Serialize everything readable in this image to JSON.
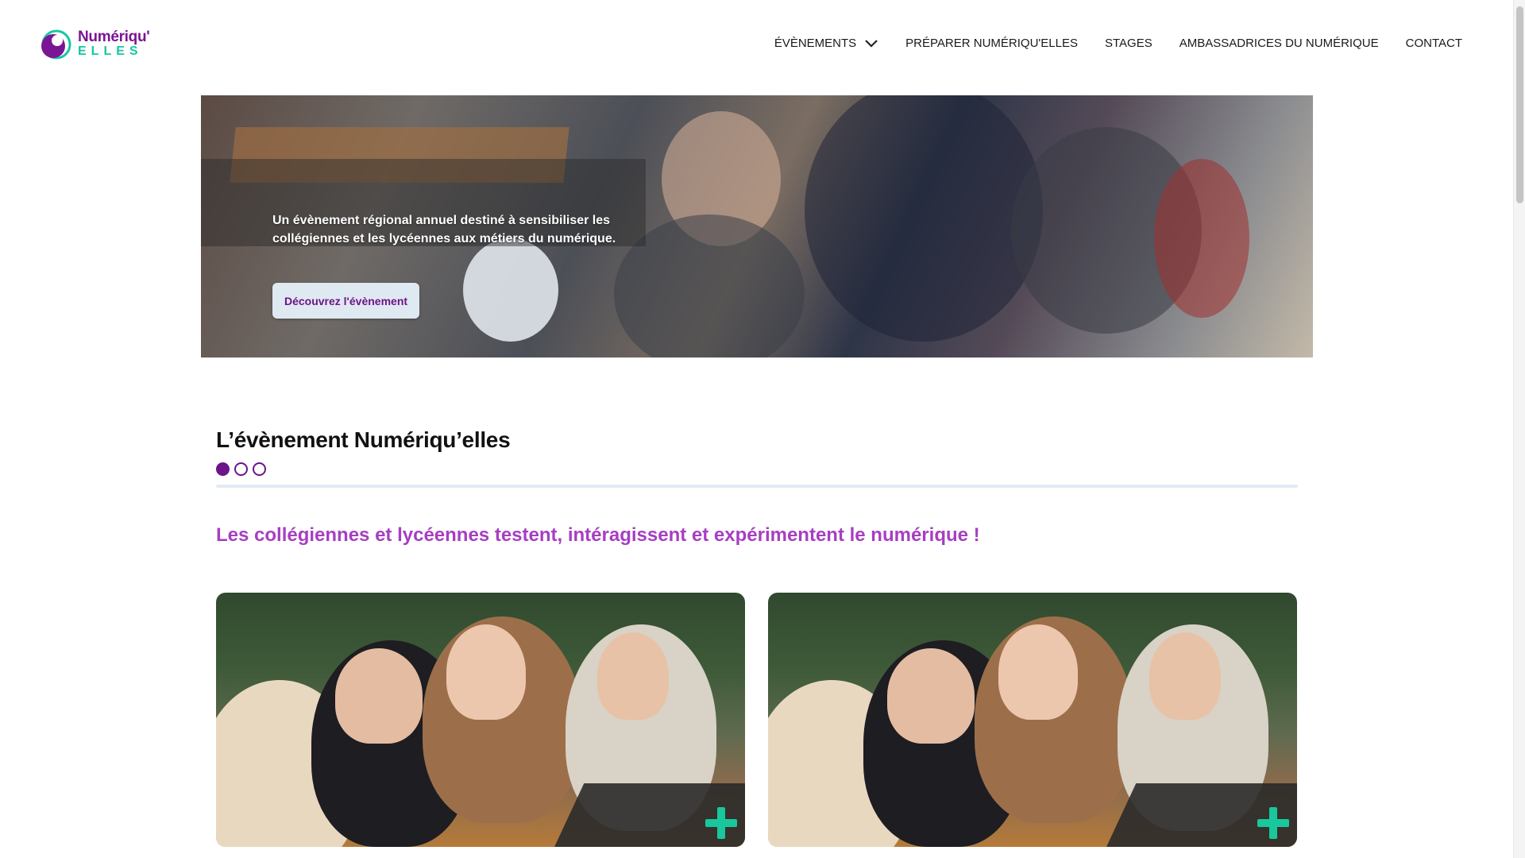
{
  "header": {
    "logo": {
      "line1": "Numériqu'",
      "line2": "ELLES"
    },
    "nav": [
      {
        "label": "ÉVÈNEMENTS",
        "has_dropdown": true
      },
      {
        "label": "PRÉPARER NUMÉRIQU'ELLES"
      },
      {
        "label": "STAGES"
      },
      {
        "label": "AMBASSADRICES DU NUMÉRIQUE"
      },
      {
        "label": "CONTACT"
      }
    ]
  },
  "hero": {
    "caption": "Un évènement régional annuel destiné à sensibiliser les collégiennes et les lycéennes aux métiers du numérique.",
    "cta_label": "Découvrez l'évènement"
  },
  "section": {
    "title": "L’évènement Numériqu’elles",
    "carousel_dots": 3,
    "active_dot": 0,
    "subtitle": "Les collégiennes et lycéennes testent, intéragissent et expérimentent le numérique !"
  },
  "cards": [
    {
      "icon": "plus-icon"
    },
    {
      "icon": "plus-icon"
    }
  ],
  "colors": {
    "brand_purple": "#6d1488",
    "subtitle_purple": "#a73ec2",
    "brand_green": "#16c7a3",
    "divider": "#e2ebf4",
    "cta_bg": "#dfe9f1"
  }
}
